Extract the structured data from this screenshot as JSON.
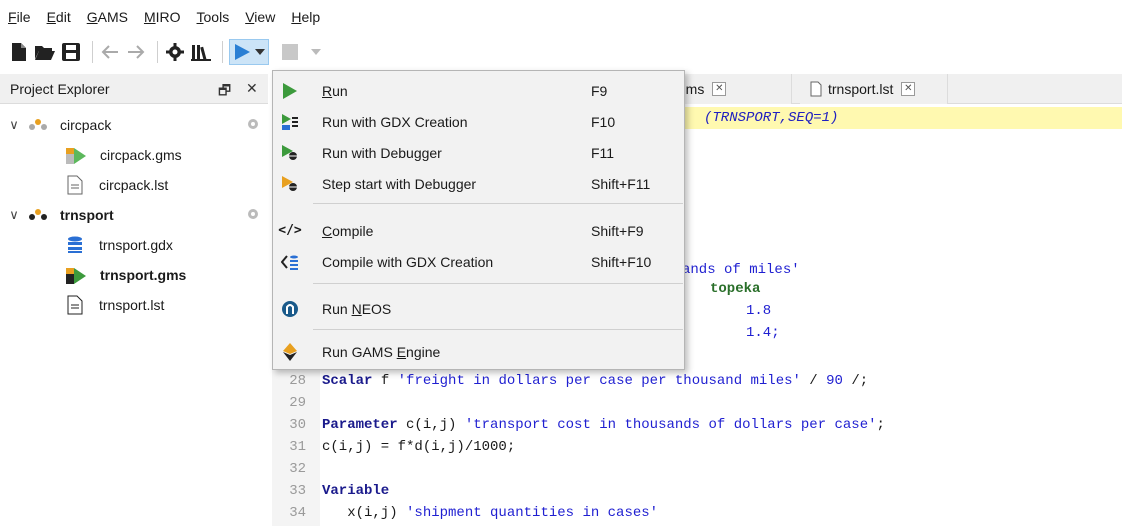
{
  "menubar": {
    "items": [
      {
        "label": "File",
        "mnemonic": "F",
        "rest": "ile"
      },
      {
        "label": "Edit",
        "mnemonic": "E",
        "rest": "dit"
      },
      {
        "label": "GAMS",
        "mnemonic": "G",
        "rest": "AMS"
      },
      {
        "label": "MIRO",
        "mnemonic": "M",
        "rest": "IRO"
      },
      {
        "label": "Tools",
        "mnemonic": "T",
        "rest": "ools"
      },
      {
        "label": "View",
        "mnemonic": "V",
        "rest": "iew"
      },
      {
        "label": "Help",
        "mnemonic": "H",
        "rest": "elp"
      }
    ]
  },
  "toolbar": {
    "icons": [
      "new-file-icon",
      "open-folder-icon",
      "save-icon",
      "back-arrow-icon",
      "forward-arrow-icon",
      "settings-gear-icon",
      "library-icon",
      "run-play-icon",
      "dropdown-arrow-icon",
      "stop-icon",
      "dropdown-arrow-icon"
    ]
  },
  "explorer": {
    "title": "Project Explorer",
    "float_btn": "🗗",
    "close_btn": "✕",
    "tree": [
      {
        "name": "circpack",
        "type": "project",
        "expanded": true,
        "bold": false
      },
      {
        "name": "circpack.gms",
        "type": "gms",
        "bold": false
      },
      {
        "name": "circpack.lst",
        "type": "lst",
        "bold": false
      },
      {
        "name": "trnsport",
        "type": "project",
        "expanded": true,
        "bold": true
      },
      {
        "name": "trnsport.gdx",
        "type": "gdx",
        "bold": false
      },
      {
        "name": "trnsport.gms",
        "type": "gms-main",
        "bold": true
      },
      {
        "name": "trnsport.lst",
        "type": "lst",
        "bold": false
      }
    ]
  },
  "tabs": [
    {
      "label": "ck.gms"
    },
    {
      "label": "trnsport.lst"
    }
  ],
  "editor": {
    "visible_fragments": {
      "title_tail": "(TRNSPORT,SEQ=1)",
      "ands_line": "ands of miles'",
      "topeka": "topeka",
      "v1": "1.8",
      "v2": "1.4;"
    },
    "lines": [
      {
        "n": "28",
        "kw": "Scalar",
        "rest": " f ",
        "str": "'freight in dollars per case per thousand miles'",
        "tail": " / ",
        "num": "90",
        "end": " /;"
      },
      {
        "n": "29"
      },
      {
        "n": "30",
        "kw": "Parameter",
        "rest": " c(i,j) ",
        "str": "'transport cost in thousands of dollars per case'",
        "tail": ";"
      },
      {
        "n": "31",
        "plain": "c(i,j) = f*d(i,j)/1000;"
      },
      {
        "n": "32"
      },
      {
        "n": "33",
        "kw": "Variable"
      },
      {
        "n": "34",
        "plain": "   x(i,j) ",
        "str": "'shipment quantities in cases'"
      }
    ]
  },
  "run_menu": {
    "items": [
      {
        "label": "Run",
        "mnemonic": "R",
        "rest": "un",
        "shortcut": "F9",
        "icon": "run-play-icon"
      },
      {
        "label": "Run with GDX Creation",
        "shortcut": "F10",
        "icon": "run-gdx-icon"
      },
      {
        "label": "Run with Debugger",
        "shortcut": "F11",
        "icon": "run-debugger-icon"
      },
      {
        "label": "Step start with Debugger",
        "shortcut": "Shift+F11",
        "icon": "step-debugger-icon"
      },
      {
        "label": "Compile",
        "mnemonic": "C",
        "rest": "ompile",
        "shortcut": "Shift+F9",
        "icon": "compile-icon"
      },
      {
        "label": "Compile with GDX Creation",
        "shortcut": "Shift+F10",
        "icon": "compile-gdx-icon"
      },
      {
        "label": "Run NEOS",
        "pre": "Run ",
        "mnemonic": "N",
        "rest": "EOS",
        "icon": "neos-icon"
      },
      {
        "label": "Run GAMS Engine",
        "pre": "Run GAMS ",
        "mnemonic": "E",
        "rest": "ngine",
        "icon": "gams-engine-icon"
      }
    ]
  },
  "colors": {
    "run_green": "#3c9a3c",
    "highlight_line": "#fff9b0",
    "keyword": "#1a1a8c",
    "string": "#1f1fd1"
  }
}
